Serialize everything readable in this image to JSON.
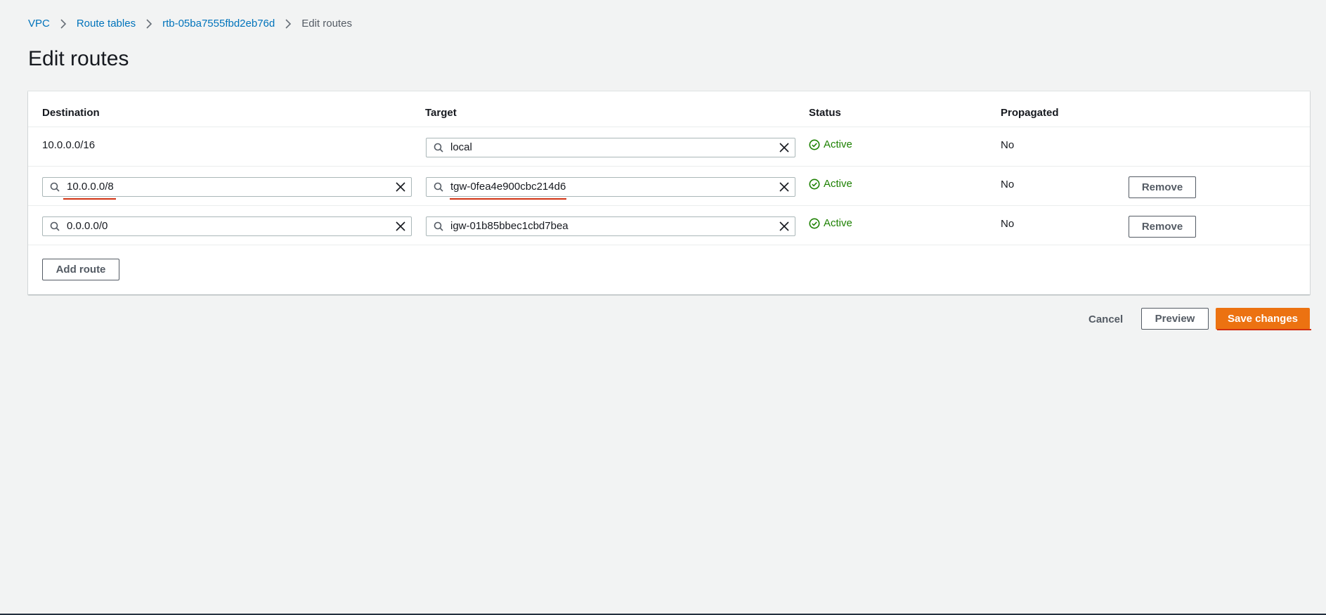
{
  "breadcrumb": {
    "items": [
      "VPC",
      "Route tables",
      "rtb-05ba7555fbd2eb76d"
    ],
    "current": "Edit routes"
  },
  "page": {
    "title": "Edit routes"
  },
  "table": {
    "headers": {
      "destination": "Destination",
      "target": "Target",
      "status": "Status",
      "propagated": "Propagated"
    },
    "rows": [
      {
        "destination": "10.0.0.0/16",
        "target": "local",
        "status": "Active",
        "propagated": "No"
      },
      {
        "destination": "10.0.0.0/8",
        "target": "tgw-0fea4e900cbc214d6",
        "status": "Active",
        "propagated": "No",
        "remove": "Remove"
      },
      {
        "destination": "0.0.0.0/0",
        "target": "igw-01b85bbec1cbd7bea",
        "status": "Active",
        "propagated": "No",
        "remove": "Remove"
      }
    ],
    "add_route": "Add route"
  },
  "actions": {
    "cancel": "Cancel",
    "preview": "Preview",
    "save": "Save changes"
  },
  "colors": {
    "link": "#0073bb",
    "success": "#1d8102",
    "primary": "#ec7211",
    "annotation": "#d13212"
  },
  "icons": [
    "chevron-right-icon",
    "search-icon",
    "clear-icon",
    "status-success-icon"
  ]
}
